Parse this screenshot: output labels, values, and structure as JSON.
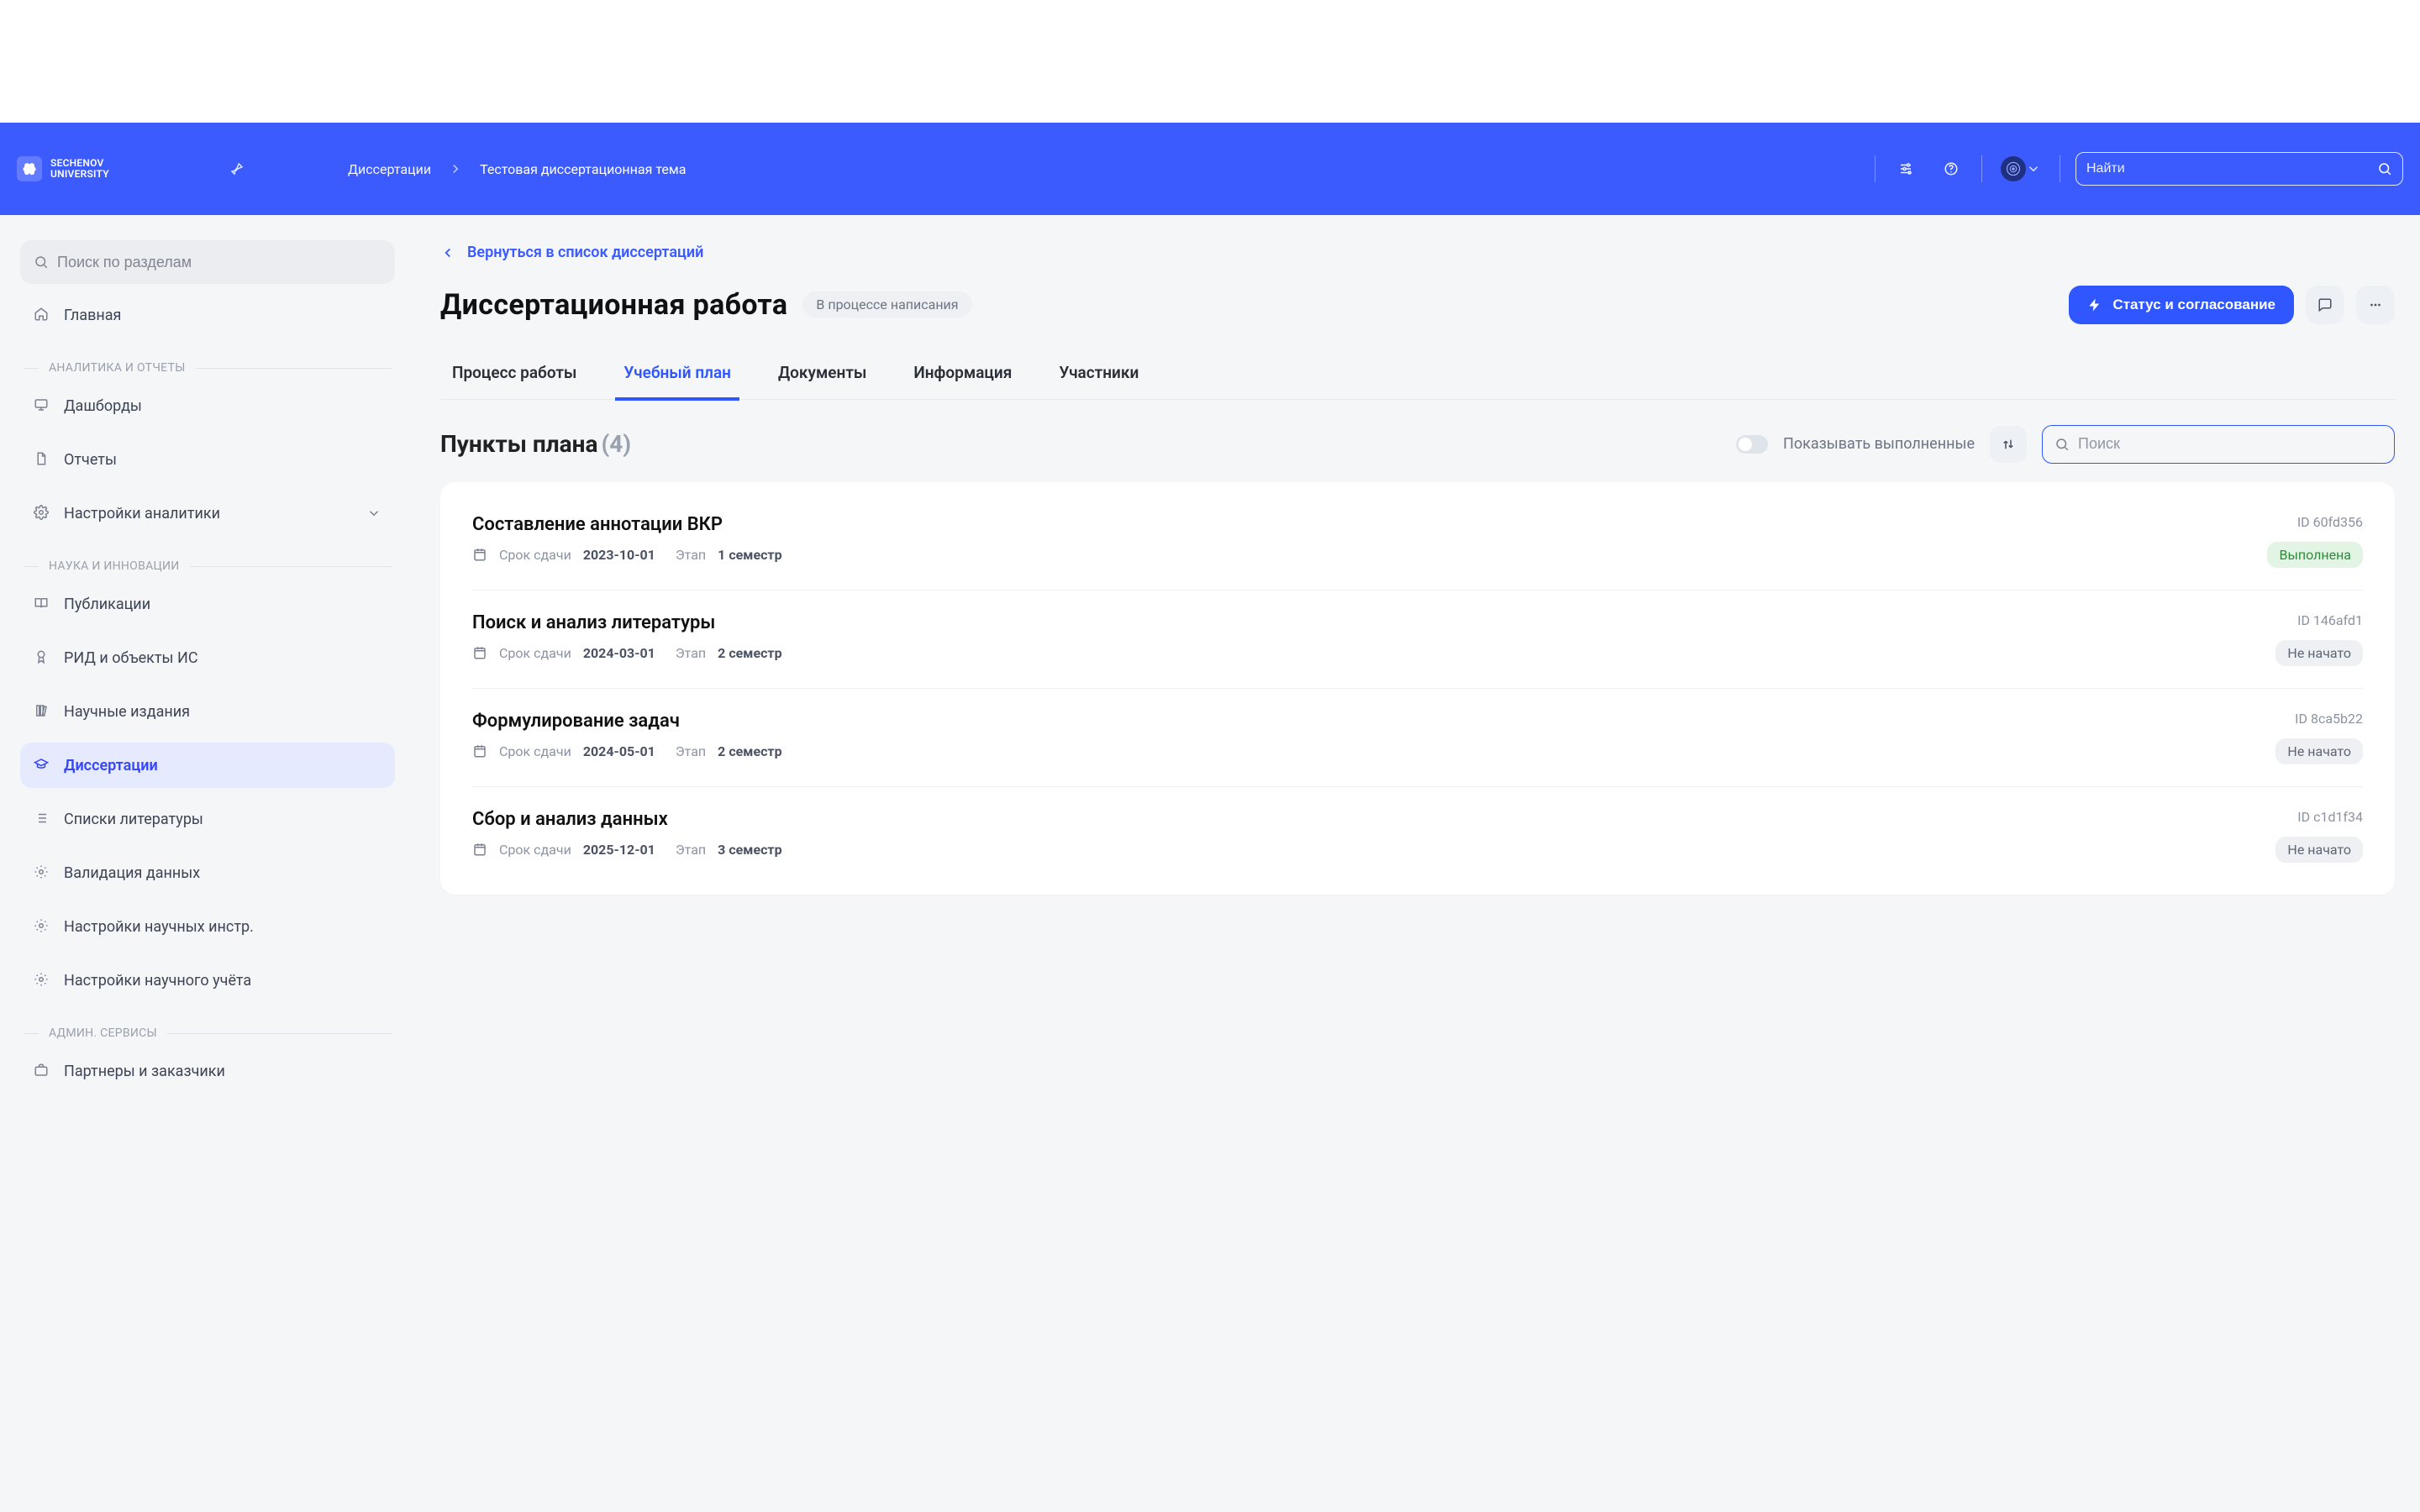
{
  "header": {
    "logo_line1": "SECHENOV",
    "logo_line2": "UNIVERSITY",
    "breadcrumb_root": "Диссертации",
    "breadcrumb_current": "Тестовая диссертационная тема",
    "search_placeholder": "Найти"
  },
  "sidebar": {
    "search_placeholder": "Поиск по разделам",
    "home": "Главная",
    "group_analytics": "АНАЛИТИКА И ОТЧЕТЫ",
    "dashboards": "Дашборды",
    "reports": "Отчеты",
    "analytics_settings": "Настройки аналитики",
    "group_science": "НАУКА И ИННОВАЦИИ",
    "publications": "Публикации",
    "rid": "РИД и объекты ИС",
    "scientific_editions": "Научные издания",
    "dissertations": "Диссертации",
    "lit_lists": "Списки литературы",
    "data_validation": "Валидация данных",
    "sci_tools_settings": "Настройки научных инстр.",
    "sci_account_settings": "Настройки научного учёта",
    "group_admin": "АДМИН. СЕРВИСЫ",
    "partners": "Партнеры и заказчики"
  },
  "main": {
    "back_link": "Вернуться в список диссертаций",
    "page_title": "Диссертационная работа",
    "writing_status": "В процессе написания",
    "status_button": "Статус и согласование",
    "tabs": {
      "process": "Процесс работы",
      "plan": "Учебный план",
      "documents": "Документы",
      "info": "Информация",
      "participants": "Участники"
    },
    "plan_title": "Пункты плана",
    "plan_count": "(4)",
    "show_completed": "Показывать выполненные",
    "plan_search_placeholder": "Поиск",
    "meta_due": "Срок сдачи",
    "meta_stage": "Этап",
    "id_prefix": "ID",
    "items": [
      {
        "title": "Составление аннотации ВКР",
        "due": "2023-10-01",
        "stage": "1 семестр",
        "id": "60fd356",
        "status_label": "Выполнена",
        "status_kind": "done"
      },
      {
        "title": "Поиск и анализ литературы",
        "due": "2024-03-01",
        "stage": "2 семестр",
        "id": "146afd1",
        "status_label": "Не начато",
        "status_kind": "grey"
      },
      {
        "title": "Формулирование задач",
        "due": "2024-05-01",
        "stage": "2 семестр",
        "id": "8ca5b22",
        "status_label": "Не начато",
        "status_kind": "grey"
      },
      {
        "title": "Сбор и анализ данных",
        "due": "2025-12-01",
        "stage": "3 семестр",
        "id": "c1d1f34",
        "status_label": "Не начато",
        "status_kind": "grey"
      }
    ]
  }
}
